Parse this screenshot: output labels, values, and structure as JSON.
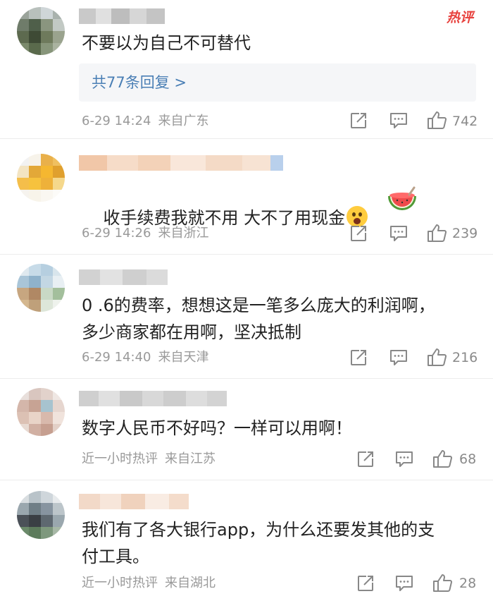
{
  "hot_badge": "热评",
  "comments": [
    {
      "text": "不要以为自己不可替代",
      "reply_link": "共77条回复 >",
      "time": "6-29 14:24",
      "location": "来自广东",
      "likes": "742"
    },
    {
      "text": "收手续费我就不用 大不了用现金",
      "emoji": [
        "astonished-face",
        "watermelon"
      ],
      "time": "6-29 14:26",
      "location": "来自浙江",
      "likes": "239"
    },
    {
      "text": "0 .6的费率，想想这是一笔多么庞大的利润啊，\n多少商家都在用啊，坚决抵制",
      "time": "6-29 14:40",
      "location": "来自天津",
      "likes": "216"
    },
    {
      "text": "数字人民币不好吗？一样可以用啊！",
      "time": "近一小时热评",
      "location": "来自江苏",
      "likes": "68"
    },
    {
      "text": "我们有了各大银行app，为什么还要发其他的支\n付工具。",
      "time": "近一小时热评",
      "location": "来自湖北",
      "likes": "28"
    }
  ],
  "icons": [
    "share-icon",
    "comment-icon",
    "like-icon"
  ],
  "colors": {
    "link": "#4a7fb5",
    "meta": "#999999",
    "badge": "#e8433f"
  }
}
